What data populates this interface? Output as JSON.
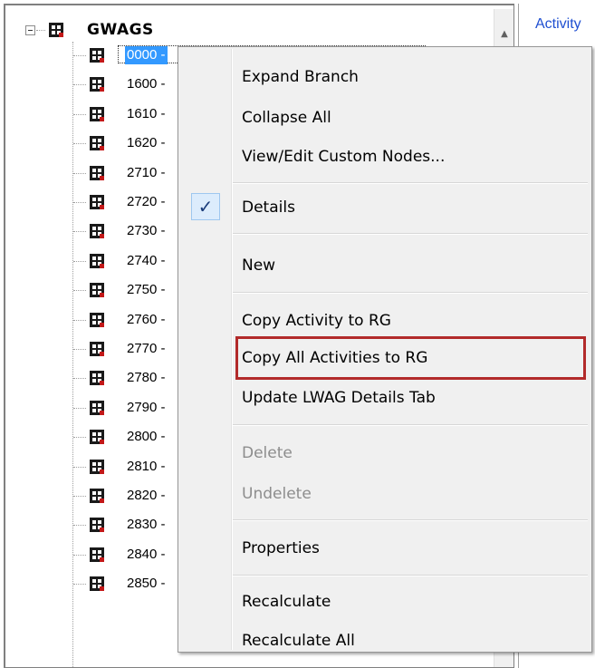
{
  "tree": {
    "root_label": "GWAGS",
    "children": [
      {
        "label": "0000 -",
        "selected": true
      },
      {
        "label": "1600 -"
      },
      {
        "label": "1610 -"
      },
      {
        "label": "1620 -"
      },
      {
        "label": "2710 -"
      },
      {
        "label": "2720 -"
      },
      {
        "label": "2730 -"
      },
      {
        "label": "2740 -"
      },
      {
        "label": "2750 -"
      },
      {
        "label": "2760 -"
      },
      {
        "label": "2770 -"
      },
      {
        "label": "2780 -"
      },
      {
        "label": "2790 -"
      },
      {
        "label": "2800 -"
      },
      {
        "label": "2810 -"
      },
      {
        "label": "2820 -"
      },
      {
        "label": "2830 -"
      },
      {
        "label": "2840 -"
      },
      {
        "label": "2850 -"
      }
    ]
  },
  "right_panel": {
    "tab_label": "Activity"
  },
  "context_menu": {
    "items": [
      {
        "label": "Expand Branch",
        "enabled": true
      },
      {
        "label": "Collapse All",
        "enabled": true
      },
      {
        "label": "View/Edit Custom Nodes...",
        "enabled": true
      },
      {
        "label": "Details",
        "enabled": true,
        "checked": true
      },
      {
        "label": "New",
        "enabled": true
      },
      {
        "label": "Copy Activity to RG",
        "enabled": true
      },
      {
        "label": "Copy All Activities to RG",
        "enabled": true,
        "highlighted": true
      },
      {
        "label": "Update LWAG Details Tab",
        "enabled": true
      },
      {
        "label": "Delete",
        "enabled": false
      },
      {
        "label": "Undelete",
        "enabled": false
      },
      {
        "label": "Properties",
        "enabled": true
      },
      {
        "label": "Recalculate",
        "enabled": true
      },
      {
        "label": "Recalculate All",
        "enabled": true
      }
    ],
    "check_glyph": "✓"
  },
  "icons": {
    "node_icon": "film-grid-icon",
    "expander": "collapse-minus-icon",
    "scroll_up": "scroll-up-arrow-icon"
  },
  "colors": {
    "selection_bg": "#3399ff",
    "highlight_border": "#b22a2a",
    "tab_text": "#1f4fd1"
  }
}
